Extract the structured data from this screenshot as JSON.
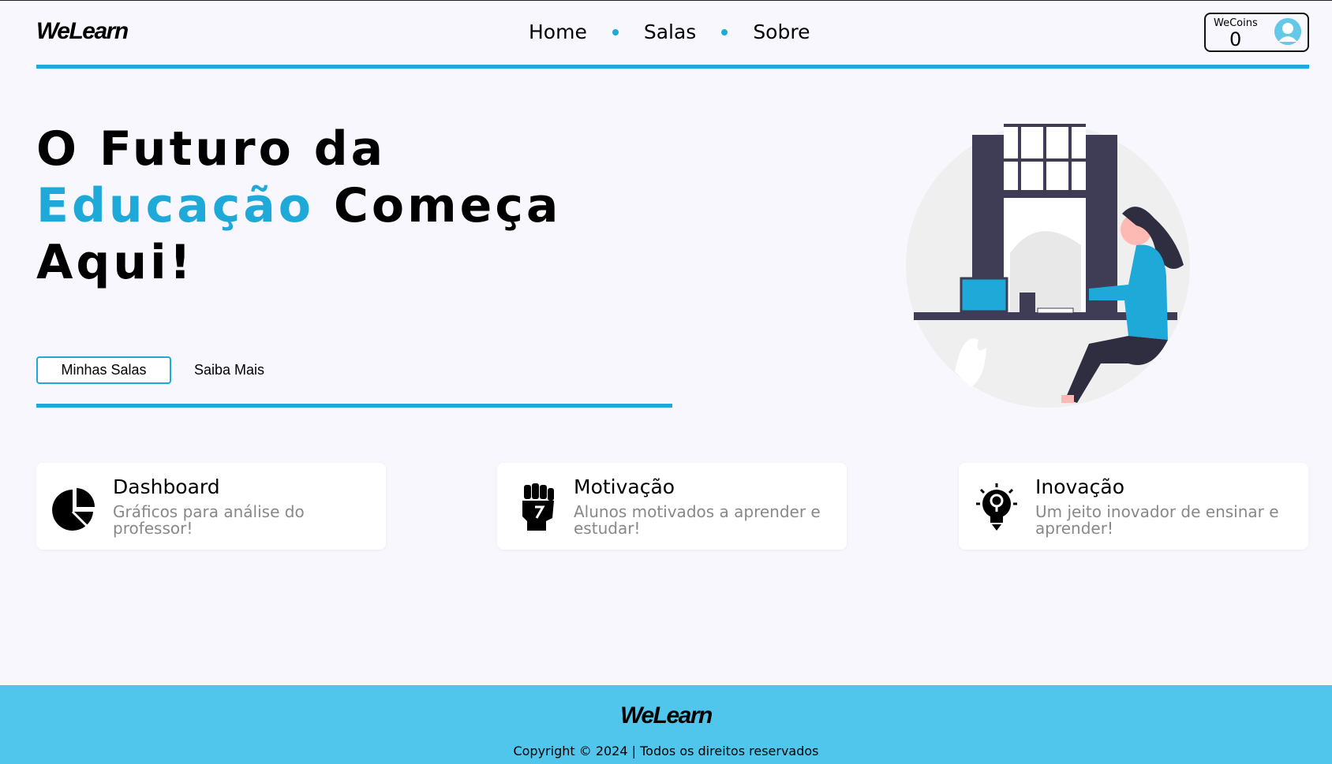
{
  "header": {
    "logo": "WeLearn",
    "nav": [
      "Home",
      "Salas",
      "Sobre"
    ],
    "wallet": {
      "label": "WeCoins",
      "value": "0"
    }
  },
  "hero": {
    "title_part1": "O Futuro da",
    "title_accent": "Educação",
    "title_part2": "Começa",
    "title_part3": "Aqui!",
    "primary_button": "Minhas Salas",
    "secondary_button": "Saiba Mais"
  },
  "cards": [
    {
      "icon": "pie-chart-icon",
      "title": "Dashboard",
      "desc": "Gráficos para análise do professor!"
    },
    {
      "icon": "fist-icon",
      "title": "Motivação",
      "desc": "Alunos motivados a aprender e estudar!"
    },
    {
      "icon": "lightbulb-icon",
      "title": "Inovação",
      "desc": "Um jeito inovador de ensinar e aprender!"
    }
  ],
  "footer": {
    "logo": "WeLearn",
    "copyright": "Copyright © 2024 | Todos os direitos reservados"
  },
  "colors": {
    "accent": "#1ea9d8",
    "footer": "#50c6ec",
    "background": "#f7f7fd"
  }
}
